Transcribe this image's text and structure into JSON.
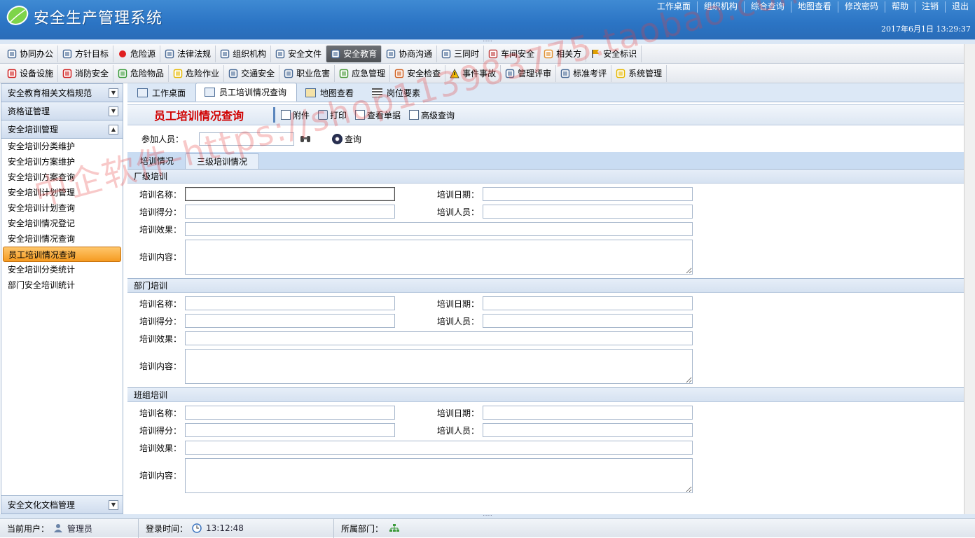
{
  "header": {
    "title": "安全生产管理系统",
    "nav": [
      "工作桌面",
      "组织机构",
      "综合查询",
      "地图查看",
      "修改密码",
      "帮助",
      "注销",
      "退出"
    ],
    "datetime": "2017年6月1日 13:29:37"
  },
  "toolbar1": {
    "items": [
      {
        "label": "协同办公",
        "icon": "people-icon"
      },
      {
        "label": "方针目标",
        "icon": "clock-icon"
      },
      {
        "label": "危险源",
        "icon": "red-dot-icon"
      },
      {
        "label": "法律法规",
        "icon": "table-icon"
      },
      {
        "label": "组织机构",
        "icon": "org-icon"
      },
      {
        "label": "安全文件",
        "icon": "document-icon"
      },
      {
        "label": "安全教育",
        "icon": "chat-icon",
        "active": true
      },
      {
        "label": "协商沟通",
        "icon": "mail-icon"
      },
      {
        "label": "三同时",
        "icon": "list-icon"
      },
      {
        "label": "车间安全",
        "icon": "user-lock-icon"
      },
      {
        "label": "相关方",
        "icon": "handshake-icon"
      },
      {
        "label": "安全标识",
        "icon": "flag-icon"
      }
    ]
  },
  "toolbar2": {
    "items": [
      {
        "label": "设备设施",
        "icon": "device-icon"
      },
      {
        "label": "消防安全",
        "icon": "extinguisher-icon"
      },
      {
        "label": "危险物品",
        "icon": "flask-icon"
      },
      {
        "label": "危险作业",
        "icon": "hazard-icon"
      },
      {
        "label": "交通安全",
        "icon": "car-icon"
      },
      {
        "label": "职业危害",
        "icon": "worker-icon"
      },
      {
        "label": "应急管理",
        "icon": "puzzle-icon"
      },
      {
        "label": "安全检查",
        "icon": "magnifier-icon"
      },
      {
        "label": "事件事故",
        "icon": "warning-icon"
      },
      {
        "label": "管理评审",
        "icon": "review-icon"
      },
      {
        "label": "标准考评",
        "icon": "edit-icon"
      },
      {
        "label": "系统管理",
        "icon": "lock-icon"
      }
    ]
  },
  "sidebar": {
    "groups": [
      {
        "label": "安全教育相关文档规范",
        "toggle": "▼"
      },
      {
        "label": "资格证管理",
        "toggle": "▼"
      },
      {
        "label": "安全培训管理",
        "toggle": "▲"
      }
    ],
    "items": [
      "安全培训分类维护",
      "安全培训方案维护",
      "安全培训方案查询",
      "安全培训计划管理",
      "安全培训计划查询",
      "安全培训情况登记",
      "安全培训情况查询",
      "员工培训情况查询",
      "安全培训分类统计",
      "部门安全培训统计"
    ],
    "active_index": 7,
    "bottom_group": {
      "label": "安全文化文档管理",
      "toggle": "▼"
    }
  },
  "tabs": [
    {
      "label": "工作桌面",
      "active": false
    },
    {
      "label": "员工培训情况查询",
      "active": true
    },
    {
      "label": "地图查看",
      "active": false
    },
    {
      "label": "岗位要素",
      "active": false
    }
  ],
  "page": {
    "title": "员工培训情况查询",
    "actions": [
      "附件",
      "打印",
      "查看单据",
      "高级查询"
    ]
  },
  "query": {
    "label": "参加人员：",
    "value": "",
    "button": "查询"
  },
  "subtabs": [
    {
      "label": "培训情况",
      "active": false
    },
    {
      "label": "三级培训情况",
      "active": true
    }
  ],
  "sections": [
    {
      "title": "厂级培训"
    },
    {
      "title": "部门培训"
    },
    {
      "title": "班组培训"
    }
  ],
  "fields": {
    "name": "培训名称：",
    "date": "培训日期：",
    "score": "培训得分：",
    "people": "培训人员：",
    "effect": "培训效果：",
    "content": "培训内容："
  },
  "status": {
    "user_label": "当前用户：",
    "user": "管理员",
    "login_label": "登录时间：",
    "login_time": "13:12:48",
    "dept_label": "所属部门：",
    "dept": ""
  },
  "watermark": "中企软件-https://shop113983775.taobao.com",
  "colors": {
    "header": "#2b74c4",
    "active_tab_accent": "#f59b21",
    "title_red": "#d00000"
  }
}
